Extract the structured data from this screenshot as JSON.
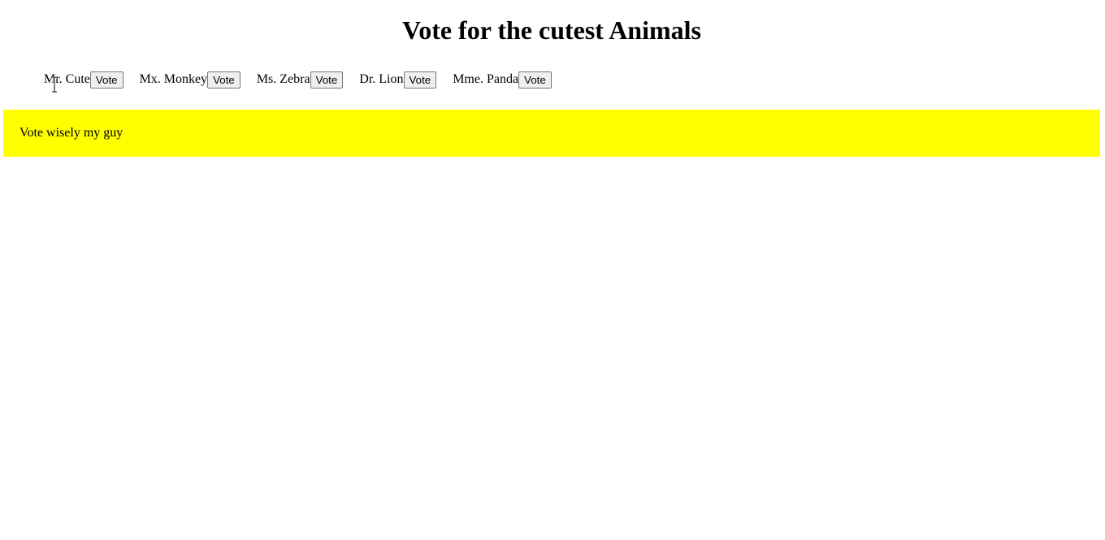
{
  "page": {
    "title": "Vote for the cutest Animals"
  },
  "candidates": [
    {
      "name": "Mr. Cute",
      "button_label": "Vote"
    },
    {
      "name": "Mx. Monkey",
      "button_label": "Vote"
    },
    {
      "name": "Ms. Zebra",
      "button_label": "Vote"
    },
    {
      "name": "Dr. Lion",
      "button_label": "Vote"
    },
    {
      "name": "Mme. Panda",
      "button_label": "Vote"
    }
  ],
  "notice": {
    "text": "Vote wisely my guy",
    "background_color": "#ffff00"
  },
  "cursor": {
    "icon": "text-cursor-icon"
  }
}
